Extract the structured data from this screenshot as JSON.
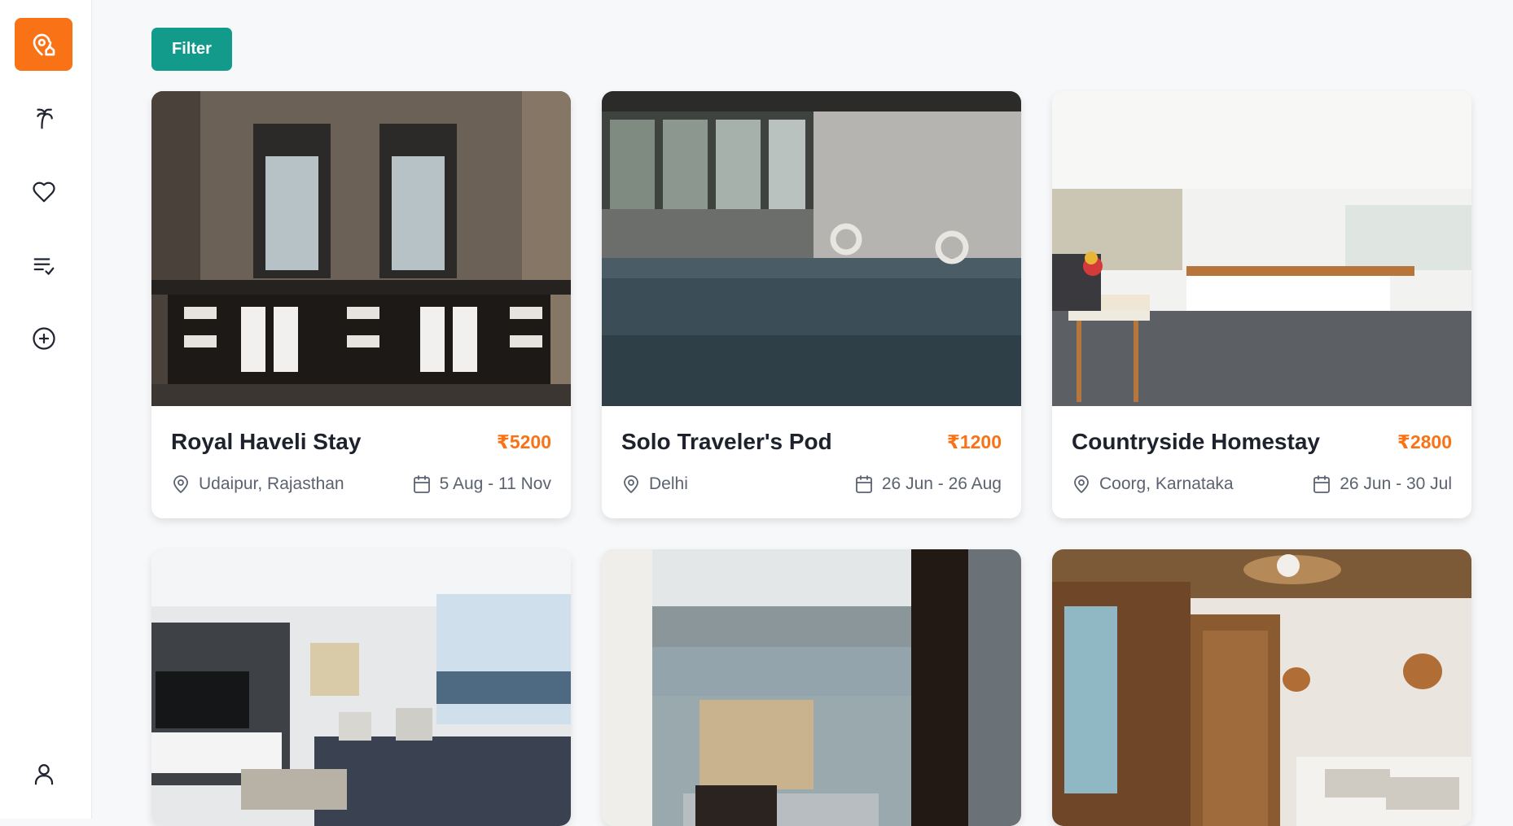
{
  "sidebar": {
    "logo_icon": "map-pin-home-icon",
    "items": [
      {
        "icon": "palm-tree-icon"
      },
      {
        "icon": "heart-icon"
      },
      {
        "icon": "list-check-icon"
      },
      {
        "icon": "plus-circle-icon"
      },
      {
        "icon": "user-icon"
      }
    ],
    "accent": "#f97316"
  },
  "toolbar": {
    "filter_label": "Filter",
    "filter_color": "#129b8a"
  },
  "listings": [
    {
      "title": "Royal Haveli Stay",
      "price": "₹5200",
      "location": "Udaipur, Rajasthan",
      "dates": "5 Aug - 11 Nov"
    },
    {
      "title": "Solo Traveler's Pod",
      "price": "₹1200",
      "location": "Delhi",
      "dates": "26 Jun - 26 Aug"
    },
    {
      "title": "Countryside Homestay",
      "price": "₹2800",
      "location": "Coorg, Karnataka",
      "dates": "26 Jun - 30 Jul"
    },
    {
      "title": "",
      "price": "",
      "location": "",
      "dates": ""
    },
    {
      "title": "",
      "price": "",
      "location": "",
      "dates": ""
    },
    {
      "title": "",
      "price": "",
      "location": "",
      "dates": ""
    }
  ]
}
